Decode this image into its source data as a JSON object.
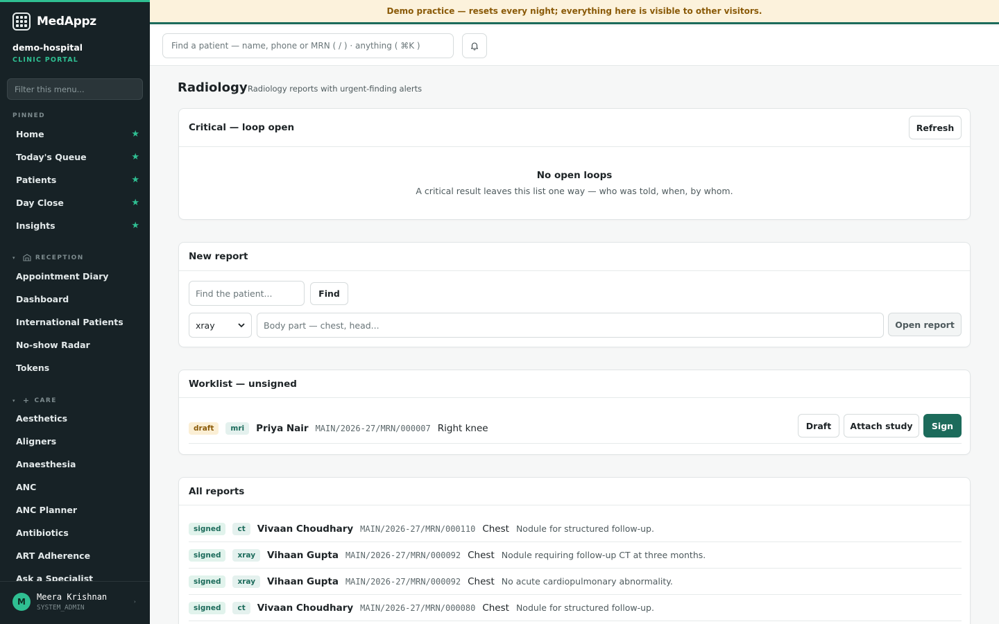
{
  "banner": {
    "text": "Demo practice — resets every night; everything here is visible to other visitors."
  },
  "sidebar": {
    "brand": "MedAppz",
    "org_name": "demo-hospital",
    "org_sub": "CLINIC PORTAL",
    "filter_placeholder": "Filter this menu...",
    "pinned_label": "PINNED",
    "pinned": [
      {
        "label": "Home"
      },
      {
        "label": "Today's Queue"
      },
      {
        "label": "Patients"
      },
      {
        "label": "Day Close"
      },
      {
        "label": "Insights"
      }
    ],
    "reception_label": "RECEPTION",
    "reception": [
      {
        "label": "Appointment Diary"
      },
      {
        "label": "Dashboard"
      },
      {
        "label": "International Patients"
      },
      {
        "label": "No-show Radar"
      },
      {
        "label": "Tokens"
      }
    ],
    "care_label": "CARE",
    "care": [
      {
        "label": "Aesthetics"
      },
      {
        "label": "Aligners"
      },
      {
        "label": "Anaesthesia"
      },
      {
        "label": "ANC"
      },
      {
        "label": "ANC Planner"
      },
      {
        "label": "Antibiotics"
      },
      {
        "label": "ART Adherence"
      },
      {
        "label": "Ask a Specialist"
      }
    ],
    "user": {
      "initial": "M",
      "name": "Meera Krishnan",
      "role": "SYSTEM_ADMIN"
    }
  },
  "header": {
    "search_placeholder": "Find a patient — name, phone or MRN ( / ) · anything ( ⌘K )"
  },
  "page": {
    "title": "Radiology",
    "subtitle": "Radiology reports with urgent-finding alerts"
  },
  "critical": {
    "title": "Critical — loop open",
    "refresh_label": "Refresh",
    "empty_title": "No open loops",
    "empty_sub": "A critical result leaves this list one way — who was told, when, by whom."
  },
  "new_report": {
    "title": "New report",
    "patient_placeholder": "Find the patient...",
    "find_label": "Find",
    "modality_value": "xray",
    "body_part_placeholder": "Body part — chest, head...",
    "open_label": "Open report"
  },
  "worklist": {
    "title": "Worklist — unsigned",
    "rows": [
      {
        "status": "draft",
        "modality": "mri",
        "patient": "Priya Nair",
        "mrn": "MAIN/2026-27/MRN/000007",
        "part": "Right knee"
      }
    ],
    "draft_label": "Draft",
    "attach_label": "Attach study",
    "sign_label": "Sign"
  },
  "all_reports": {
    "title": "All reports",
    "rows": [
      {
        "status": "signed",
        "modality": "ct",
        "patient": "Vivaan Choudhary",
        "mrn": "MAIN/2026-27/MRN/000110",
        "part": "Chest",
        "note": "Nodule for structured follow-up."
      },
      {
        "status": "signed",
        "modality": "xray",
        "patient": "Vihaan Gupta",
        "mrn": "MAIN/2026-27/MRN/000092",
        "part": "Chest",
        "note": "Nodule requiring follow-up CT at three months."
      },
      {
        "status": "signed",
        "modality": "xray",
        "patient": "Vihaan Gupta",
        "mrn": "MAIN/2026-27/MRN/000092",
        "part": "Chest",
        "note": "No acute cardiopulmonary abnormality."
      },
      {
        "status": "signed",
        "modality": "ct",
        "patient": "Vivaan Choudhary",
        "mrn": "MAIN/2026-27/MRN/000080",
        "part": "Chest",
        "note": "Nodule for structured follow-up."
      }
    ]
  },
  "colors": {
    "accent": "#1c6b5b",
    "sidebar_bg": "#172226",
    "star": "#2fbf92",
    "banner_bg": "#fcf2dc",
    "banner_text": "#8a5a08"
  }
}
